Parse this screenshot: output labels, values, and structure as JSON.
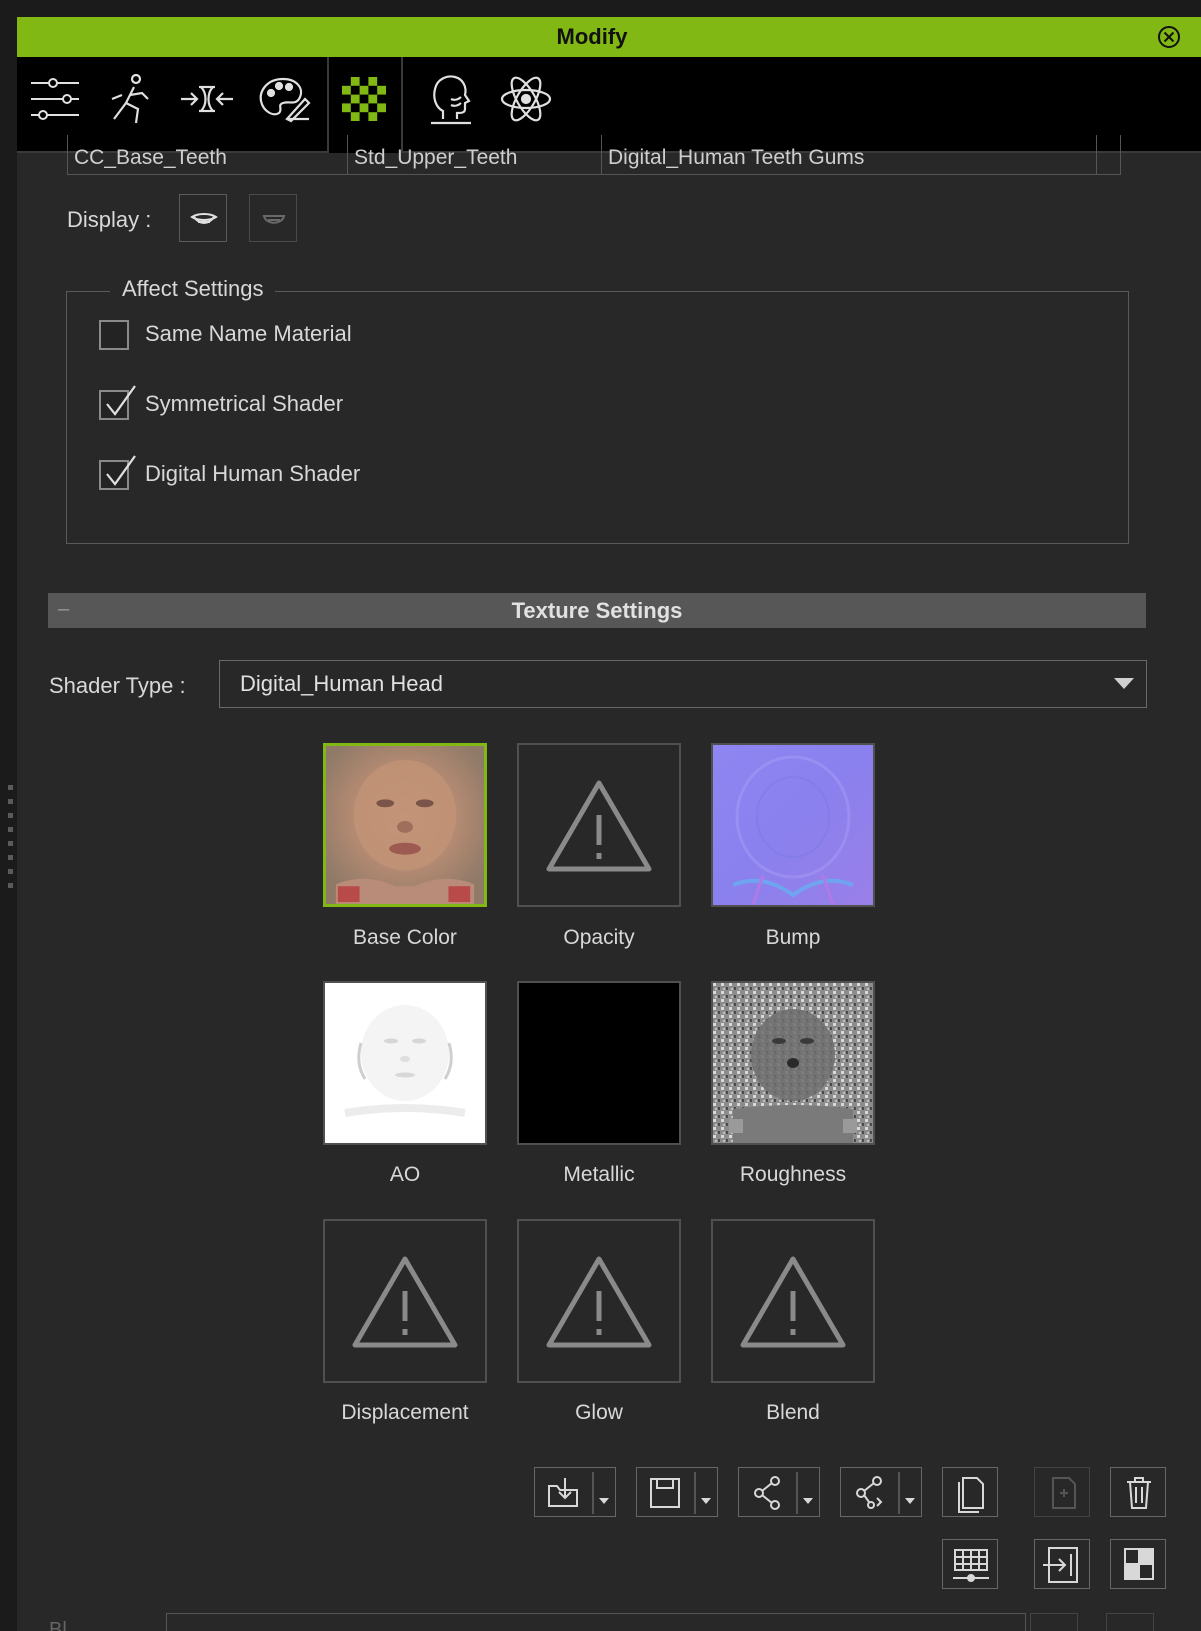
{
  "window": {
    "title": "Modify",
    "close_icon": "close-circle-icon"
  },
  "toolbar": {
    "tabs": [
      {
        "name": "sliders-icon"
      },
      {
        "name": "motion-icon"
      },
      {
        "name": "morph-icon"
      },
      {
        "name": "palette-icon"
      },
      {
        "name": "checker-material-icon",
        "active": true
      },
      {
        "name": "head-icon"
      },
      {
        "name": "atom-icon"
      }
    ],
    "accent": "#82b814"
  },
  "mesh_list": [
    "CC_Base_Teeth",
    "Std_Upper_Teeth",
    "Digital_Human Teeth Gums"
  ],
  "display": {
    "label": "Display :"
  },
  "affect": {
    "legend": "Affect Settings",
    "items": [
      {
        "label": "Same Name Material",
        "checked": false
      },
      {
        "label": "Symmetrical Shader",
        "checked": true
      },
      {
        "label": "Digital Human Shader",
        "checked": true
      }
    ]
  },
  "texture": {
    "section_title": "Texture Settings",
    "collapse_glyph": "–",
    "shader_label": "Shader Type :",
    "shader_value": "Digital_Human Head",
    "channels": [
      {
        "label": "Base Color",
        "kind": "image-face",
        "selected": true
      },
      {
        "label": "Opacity",
        "kind": "missing"
      },
      {
        "label": "Bump",
        "kind": "image-normal"
      },
      {
        "label": "AO",
        "kind": "image-ao"
      },
      {
        "label": "Metallic",
        "kind": "image-black"
      },
      {
        "label": "Roughness",
        "kind": "image-rough"
      },
      {
        "label": "Displacement",
        "kind": "missing"
      },
      {
        "label": "Glow",
        "kind": "missing"
      },
      {
        "label": "Blend",
        "kind": "missing"
      }
    ]
  },
  "actions_row1": [
    "load-icon",
    "save-icon",
    "share-icon",
    "share-alt-icon",
    "copy-icon",
    "paste-icon",
    "delete-icon"
  ],
  "actions_row2": [
    "grid-adjust-icon",
    "import-icon",
    "checker-icon"
  ],
  "bottom_partial_label": "Bl"
}
